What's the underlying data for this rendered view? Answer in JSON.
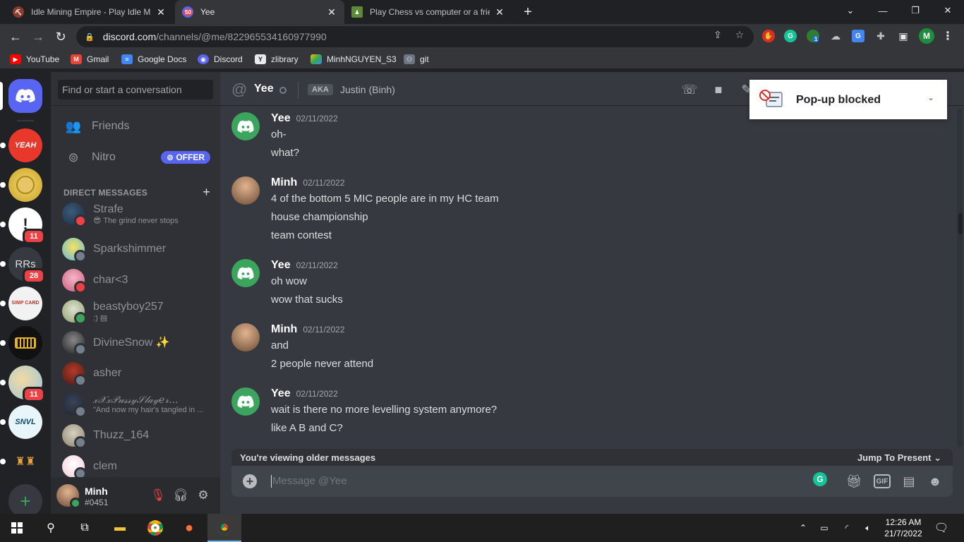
{
  "browser": {
    "tabs": [
      {
        "title": "Idle Mining Empire - Play Idle Mining",
        "active": false
      },
      {
        "title": "Yee",
        "active": true,
        "badge": "50"
      },
      {
        "title": "Play Chess vs computer or a friend",
        "active": false
      }
    ],
    "new_tab": "+",
    "url_host": "discord.com",
    "url_path": "/channels/@me/822965534160977990",
    "profile_initial": "M",
    "ext_badge": "1",
    "bookmarks": [
      "YouTube",
      "Gmail",
      "Google Docs",
      "Discord",
      "zlibrary",
      "MinhNGUYEN_S3",
      "git"
    ]
  },
  "popup_blocked": {
    "text": "Pop-up blocked"
  },
  "guilds": [
    {
      "label": "",
      "badge": ""
    },
    {
      "label": "YEAH",
      "badge": ""
    },
    {
      "label": "",
      "badge": ""
    },
    {
      "label": "",
      "badge": "11"
    },
    {
      "label": "RRs",
      "badge": "28"
    },
    {
      "label": "SIMP CARD",
      "badge": ""
    },
    {
      "label": "",
      "badge": ""
    },
    {
      "label": "",
      "badge": "11"
    },
    {
      "label": "SNVL",
      "badge": ""
    },
    {
      "label": "",
      "badge": ""
    }
  ],
  "sidebar": {
    "search_placeholder": "Find or start a conversation",
    "friends_label": "Friends",
    "nitro_label": "Nitro",
    "offer_label": "OFFER",
    "dm_header": "DIRECT MESSAGES",
    "dms": [
      {
        "name": "Strafe",
        "sub": "😎 The grind never stops",
        "status": "dnd"
      },
      {
        "name": "Sparkshimmer",
        "sub": "",
        "status": "off"
      },
      {
        "name": "char<3",
        "sub": "",
        "status": "dnd"
      },
      {
        "name": "beastyboy257",
        "sub": ":) ▤",
        "status": "on"
      },
      {
        "name": "DivineSnow ✨",
        "sub": "",
        "status": "off"
      },
      {
        "name": "asher",
        "sub": "",
        "status": "off"
      },
      {
        "name": "𝓍𝒳𝓍𝒫𝓊𝓈𝓈𝓎𝒮𝓁𝒶𝓎𝑒𝓇...",
        "sub": "\"And now my hair's tangled in ...",
        "status": "off"
      },
      {
        "name": "Thuzz_164",
        "sub": "",
        "status": "off"
      },
      {
        "name": "clem",
        "sub": "",
        "status": "off"
      }
    ],
    "user": {
      "name": "Minh",
      "tag": "#0451"
    }
  },
  "channel": {
    "name": "Yee",
    "aka_label": "AKA",
    "aka_name": "Justin (Binh)"
  },
  "messages": [
    {
      "author": "Yee",
      "time": "02/11/2022",
      "lines": [
        "oh-",
        "what?"
      ]
    },
    {
      "author": "Minh",
      "time": "02/11/2022",
      "lines": [
        "4 of the bottom 5 MIC people are in my HC team",
        "house championship",
        "team contest"
      ]
    },
    {
      "author": "Yee",
      "time": "02/11/2022",
      "lines": [
        "oh wow",
        "wow that sucks"
      ]
    },
    {
      "author": "Minh",
      "time": "02/11/2022",
      "lines": [
        "and",
        "2 people never attend"
      ]
    },
    {
      "author": "Yee",
      "time": "02/11/2022",
      "lines": [
        "wait is there no more levelling system anymore?",
        "like A B and C?"
      ]
    }
  ],
  "older_bar": {
    "text": "You're viewing older messages",
    "jump": "Jump To Present"
  },
  "composer": {
    "placeholder": "Message @Yee",
    "gif_label": "GIF"
  },
  "taskbar": {
    "time": "12:26 AM",
    "date": "21/7/2022"
  },
  "colors": {
    "blurple": "#5865f2",
    "green": "#3ba55d",
    "red": "#ed4245",
    "bg": "#36393f"
  }
}
